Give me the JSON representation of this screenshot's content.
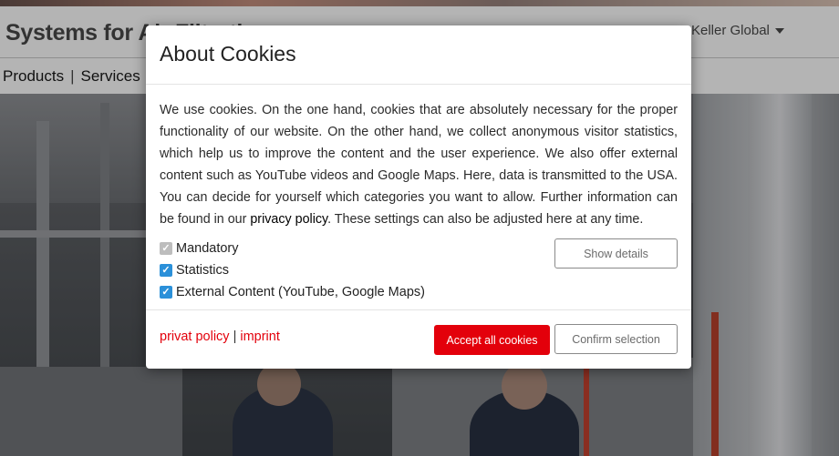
{
  "header": {
    "site_title": "Systems for Air Filtration",
    "region_selector": "Keller Global"
  },
  "nav": {
    "items": [
      {
        "label": "Products"
      },
      {
        "label": "Services"
      }
    ]
  },
  "cookie_dialog": {
    "title": "About Cookies",
    "body_before_link": "We use cookies. On the one hand, cookies that are absolutely necessary for the proper functionality of our website. On the other hand, we collect anonymous visitor statistics, which help us to improve the content and the user experience. We also offer external content such as YouTube videos and Google Maps. Here, data is transmitted to the USA. You can decide for yourself which categories you want to allow. Further information can be found in our ",
    "privacy_link": "privacy policy",
    "body_after_link": ". These settings can also be adjusted here at any time.",
    "options": [
      {
        "label": "Mandatory",
        "checked": true,
        "disabled": true
      },
      {
        "label": "Statistics",
        "checked": true,
        "disabled": false
      },
      {
        "label": "External Content (YouTube, Google Maps)",
        "checked": true,
        "disabled": false
      }
    ],
    "show_details_label": "Show details",
    "accept_all_label": "Accept all cookies",
    "confirm_label": "Confirm selection",
    "footer_links": {
      "privacy": "privat policy",
      "separator": "|",
      "imprint": "imprint"
    },
    "colors": {
      "accent_red": "#e3000b",
      "checkbox_blue": "#2b90d9"
    }
  }
}
